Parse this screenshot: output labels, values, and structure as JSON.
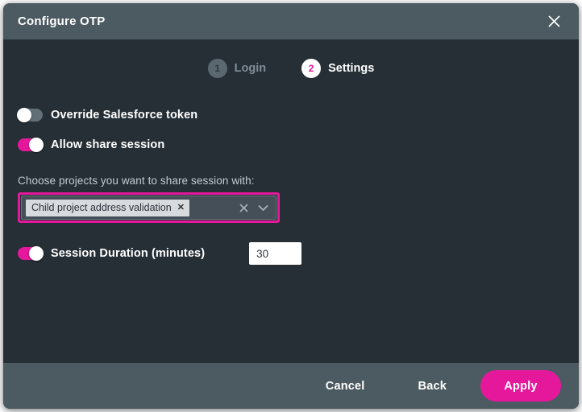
{
  "dialog": {
    "title": "Configure OTP",
    "close_icon": "close-icon"
  },
  "stepper": {
    "steps": [
      {
        "number": "1",
        "label": "Login",
        "state": "inactive"
      },
      {
        "number": "2",
        "label": "Settings",
        "state": "active"
      }
    ]
  },
  "settings": {
    "override_token": {
      "label": "Override Salesforce token",
      "value": "off"
    },
    "allow_share_session": {
      "label": "Allow share session",
      "value": "on"
    },
    "projects": {
      "label": "Choose projects you want to share session with:",
      "chips": [
        {
          "label": "Child project address validation",
          "remove_icon": "close-icon"
        }
      ],
      "clear_icon": "close-icon",
      "dropdown_icon": "chevron-down-icon"
    },
    "session_duration": {
      "label": "Session Duration (minutes)",
      "value": "30",
      "placeholder": "",
      "toggle_value": "on"
    }
  },
  "footer": {
    "cancel_label": "Cancel",
    "back_label": "Back",
    "apply_label": "Apply"
  },
  "colors": {
    "accent": "#e5189c",
    "header_bg": "#4c5a61",
    "body_bg": "#262f36",
    "field_bg": "#444f57",
    "chip_bg": "#d8dbde"
  }
}
